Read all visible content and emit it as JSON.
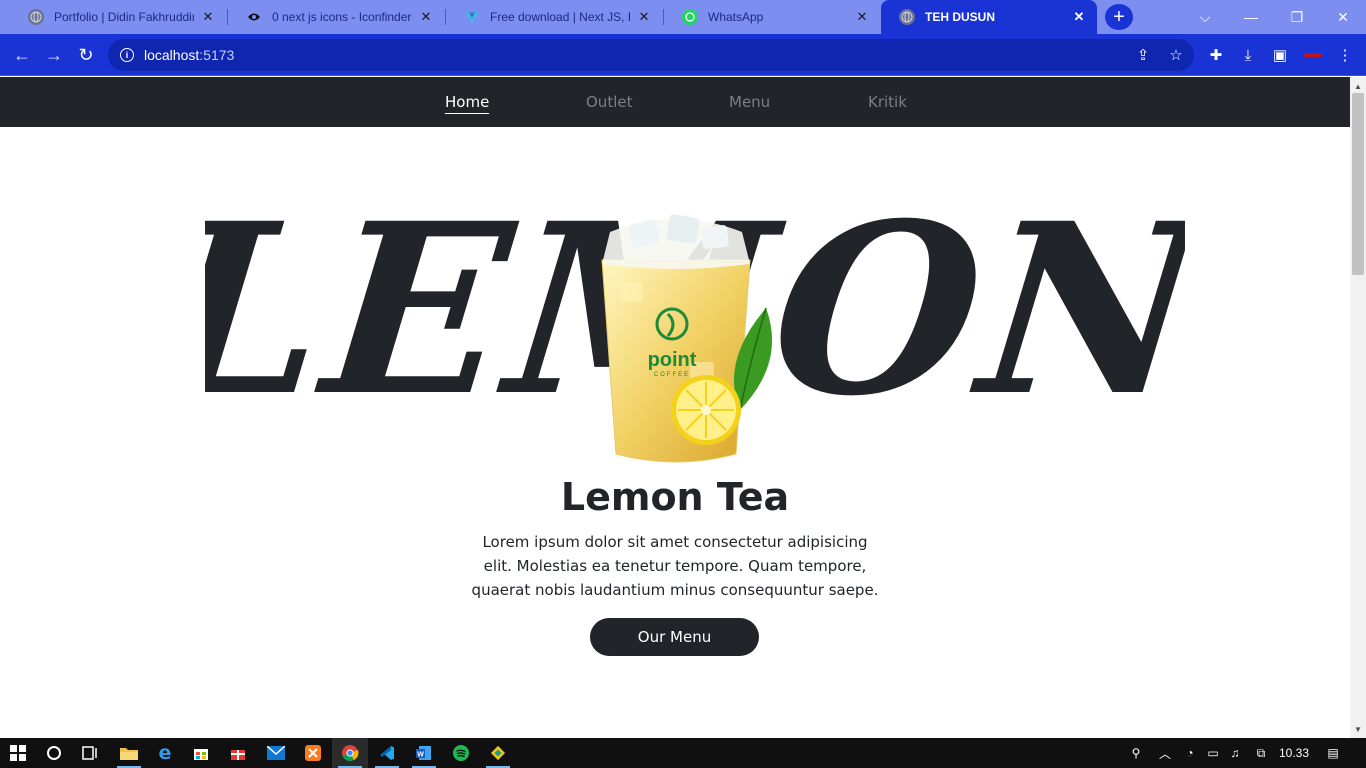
{
  "browser": {
    "tabs": [
      {
        "title": "Portfolio | Didin Fakhruddin",
        "icon": "globe-icon",
        "active": false
      },
      {
        "title": "0 next js icons - Iconfinder",
        "icon": "iconfinder-icon",
        "active": false
      },
      {
        "title": "Free download | Next JS, HD...",
        "icon": "vite-icon",
        "active": false
      },
      {
        "title": "WhatsApp",
        "icon": "whatsapp-icon",
        "active": false
      },
      {
        "title": "TEH DUSUN",
        "icon": "globe-icon",
        "active": true
      }
    ],
    "address": {
      "host": "localhost",
      "port": ":5173"
    }
  },
  "site": {
    "nav": [
      {
        "label": "Home",
        "active": true
      },
      {
        "label": "Outlet",
        "active": false
      },
      {
        "label": "Menu",
        "active": false
      },
      {
        "label": "Kritik",
        "active": false
      }
    ],
    "hero": {
      "backdrop_word": "LEMON",
      "cup_brand": "point",
      "cup_tagline": "COFFEE",
      "title": "Lemon Tea",
      "description": "Lorem ipsum dolor sit amet consectetur adipisicing elit. Molestias ea tenetur tempore. Quam tempore, quaerat nobis laudantium minus consequuntur saepe.",
      "button_label": "Our Menu"
    }
  },
  "taskbar": {
    "clock": "10.33",
    "apps": [
      "file-explorer-icon",
      "edge-icon",
      "store-icon",
      "gift-icon",
      "mail-icon",
      "xampp-icon",
      "chrome-icon",
      "vscode-icon",
      "word-icon",
      "spotify-icon",
      "git-icon"
    ]
  },
  "colors": {
    "tab_strip": "#7c8ef0",
    "toolbar": "#1a33d4",
    "site_dark": "#212529"
  }
}
